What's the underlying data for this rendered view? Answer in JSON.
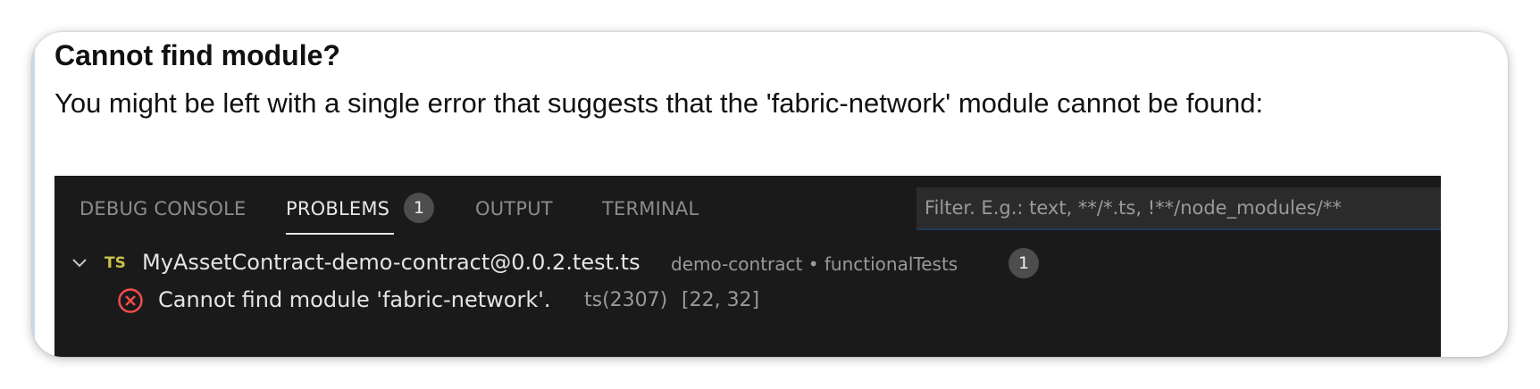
{
  "article": {
    "heading": "Cannot find module?",
    "body": "You might be left with a single error that suggests that the 'fabric-network' module cannot be found:"
  },
  "panel": {
    "tabs": [
      {
        "label": "DEBUG CONSOLE",
        "active": false
      },
      {
        "label": "PROBLEMS",
        "active": true,
        "badge": "1"
      },
      {
        "label": "OUTPUT",
        "active": false
      },
      {
        "label": "TERMINAL",
        "active": false
      }
    ],
    "filter": {
      "placeholder": "Filter. E.g.: text, **/*.ts, !**/node_modules/**"
    },
    "problems": {
      "file": {
        "icon": "chevron-down-icon",
        "lang_badge": "TS",
        "name": "MyAssetContract-demo-contract@0.0.2.test.ts",
        "path": "demo-contract • functionalTests",
        "count": "1"
      },
      "items": [
        {
          "icon": "error-icon",
          "message": "Cannot find module 'fabric-network'.",
          "code": "ts(2307)",
          "location": "[22, 32]"
        }
      ]
    }
  },
  "colors": {
    "panel_bg": "#1a1a1a",
    "error": "#f14c4c",
    "ts_icon": "#c9c34a",
    "badge_bg": "#4d4d4d"
  }
}
